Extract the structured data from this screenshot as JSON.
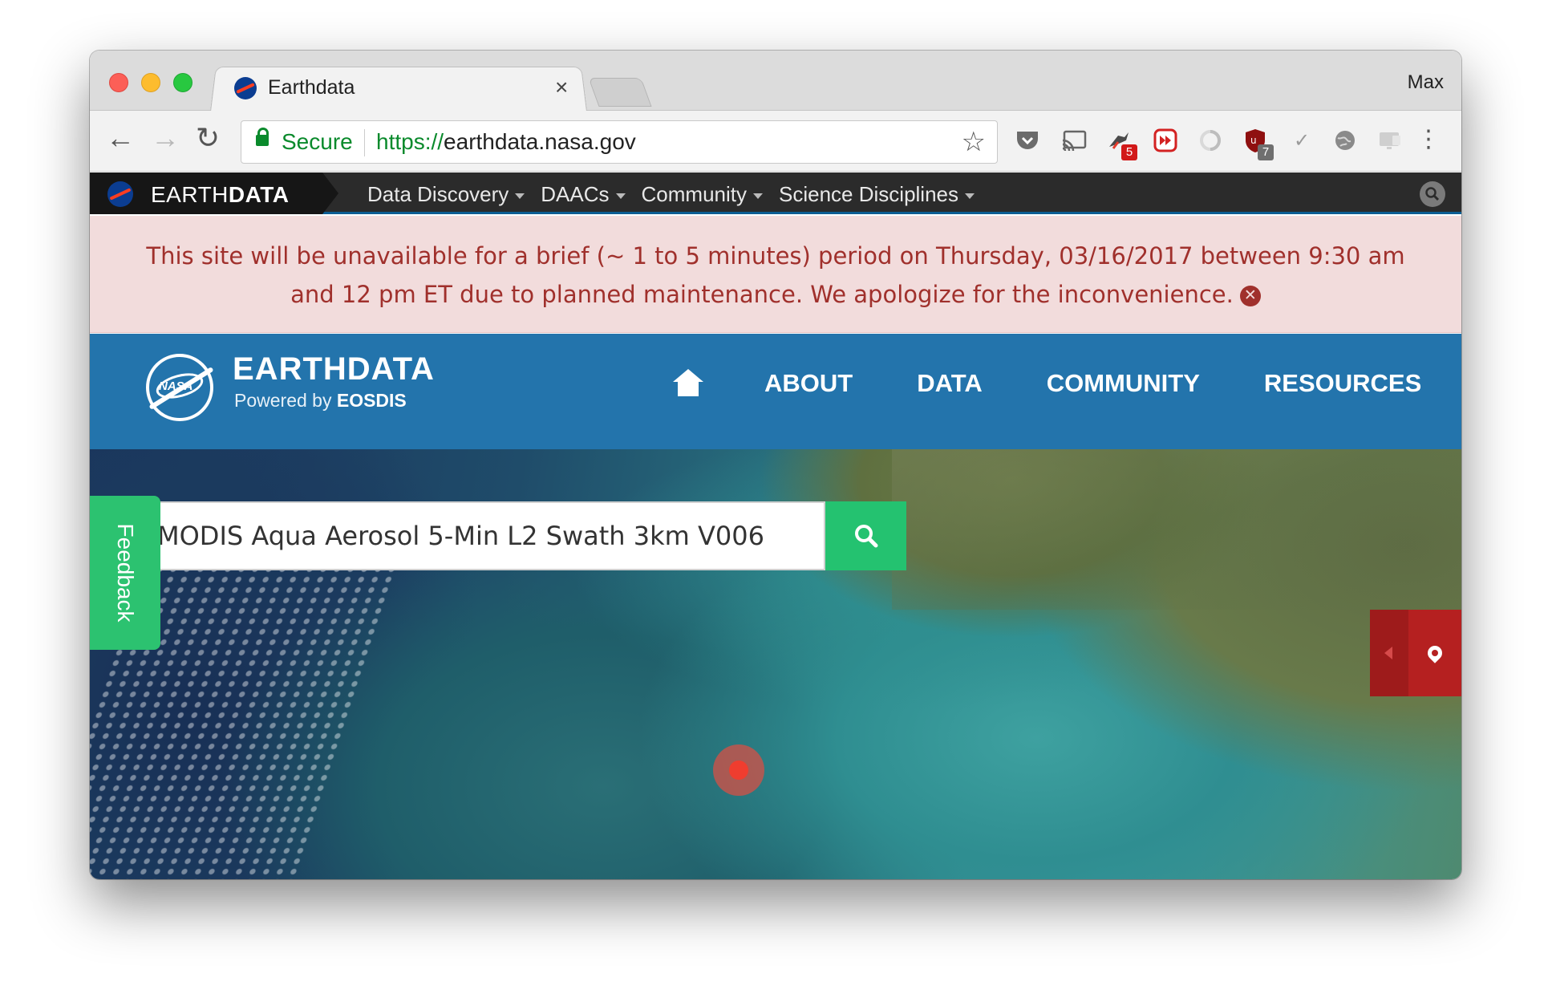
{
  "browser": {
    "tab_title": "Earthdata",
    "profile_name": "Max",
    "secure_label": "Secure",
    "url_scheme": "https://",
    "url_host": "earthdata.nasa.gov",
    "extensions": [
      {
        "icon": "pocket-icon"
      },
      {
        "icon": "cast-icon"
      },
      {
        "icon": "bird-extension-icon",
        "badge": "5"
      },
      {
        "icon": "fast-forward-extension-icon"
      },
      {
        "icon": "circle-extension-icon"
      },
      {
        "icon": "ublock-shield-icon",
        "badge": "7"
      },
      {
        "icon": "checkmark-extension-icon"
      },
      {
        "icon": "globe-extension-icon"
      },
      {
        "icon": "screen-extension-icon"
      }
    ],
    "colors": {
      "secure_green": "#0a8a2c",
      "badge_red": "#d21919"
    }
  },
  "earthdata_bar": {
    "brand_light": "EARTH",
    "brand_bold": "DATA",
    "menu": [
      {
        "label": "Data Discovery"
      },
      {
        "label": "DAACs"
      },
      {
        "label": "Community"
      },
      {
        "label": "Science Disciplines"
      }
    ]
  },
  "alert": {
    "message": "This site will be unavailable for a brief (~ 1 to 5 minutes) period on Thursday, 03/16/2017 between 9:30 am and 12 pm ET due to planned maintenance. We apologize for the inconvenience.",
    "close_glyph": "✕",
    "colors": {
      "background": "#f2dcdc",
      "text": "#a0302c"
    }
  },
  "header": {
    "logo_text": "NASA",
    "title": "EARTHDATA",
    "subtitle_prefix": "Powered by ",
    "subtitle_bold": "EOSDIS",
    "nav": [
      {
        "label": "ABOUT"
      },
      {
        "label": "DATA"
      },
      {
        "label": "COMMUNITY"
      },
      {
        "label": "RESOURCES"
      }
    ],
    "colors": {
      "background": "#2374ac"
    }
  },
  "hero": {
    "search_value": "MODIS Aqua Aerosol 5-Min L2 Swath 3km V006",
    "feedback_label": "Feedback",
    "colors": {
      "search_button": "#24c270",
      "feedback_tab": "#2cc270",
      "location_tab": "#b52020"
    }
  }
}
